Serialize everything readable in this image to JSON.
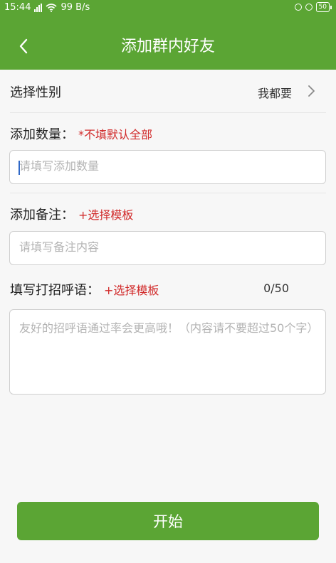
{
  "status_bar": {
    "time": "15:44",
    "network_label": "4G",
    "speed": "99 B/s",
    "battery": "50"
  },
  "header": {
    "title": "添加群内好友",
    "back_icon": "chevron-left-icon"
  },
  "gender": {
    "label": "选择性别",
    "value": "我都要"
  },
  "quantity": {
    "label": "添加数量：",
    "hint": "*不填默认全部",
    "placeholder": "请填写添加数量",
    "value": ""
  },
  "remark": {
    "label": "添加备注：",
    "template_link": "+选择模板",
    "placeholder": "请填写备注内容",
    "value": ""
  },
  "greeting": {
    "label": "填写打招呼语：",
    "template_link": "+选择模板",
    "counter": "0/50",
    "placeholder": "友好的招呼语通过率会更高哦！（内容请不要超过50个字）",
    "value": ""
  },
  "start_button": {
    "label": "开始"
  },
  "colors": {
    "brand_green": "#5ba534",
    "hint_red": "#d12a2a",
    "background": "#f7f7f7"
  }
}
